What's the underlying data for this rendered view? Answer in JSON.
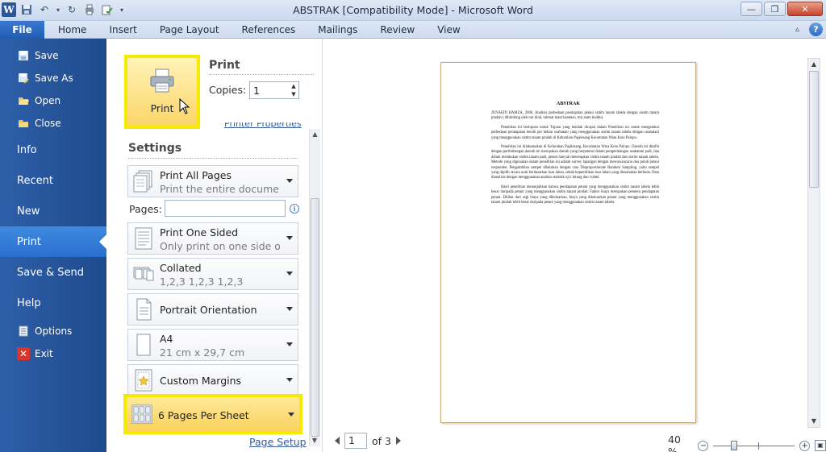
{
  "window": {
    "title": "ABSTRAK [Compatibility Mode]  -  Microsoft Word",
    "app_icon_letter": "W",
    "minimize_glyph": "—",
    "maximize_glyph": "❐",
    "close_glyph": "✕"
  },
  "ribbon": {
    "file_tab": "File",
    "tabs": [
      "Home",
      "Insert",
      "Page Layout",
      "References",
      "Mailings",
      "Review",
      "View"
    ],
    "help_glyph": "?"
  },
  "nav": {
    "items_small": [
      {
        "label": "Save",
        "icon": "save-icon"
      },
      {
        "label": "Save As",
        "icon": "save-as-icon"
      },
      {
        "label": "Open",
        "icon": "open-folder-icon"
      },
      {
        "label": "Close",
        "icon": "close-folder-icon"
      }
    ],
    "items_big": [
      "Info",
      "Recent",
      "New",
      "Print",
      "Save & Send",
      "Help"
    ],
    "selected": "Print",
    "options_label": "Options",
    "exit_label": "Exit"
  },
  "print_panel": {
    "print_button_label": "Print",
    "heading": "Print",
    "copies_label": "Copies:",
    "copies_value": "1",
    "printer_properties_link": "Printer Properties"
  },
  "settings": {
    "heading": "Settings",
    "print_range": {
      "title": "Print All Pages",
      "subtitle": "Print the entire document"
    },
    "pages_label": "Pages:",
    "pages_value": "",
    "sides": {
      "title": "Print One Sided",
      "subtitle": "Only print on one side of th..."
    },
    "collation": {
      "title": "Collated",
      "subtitle": "1,2,3    1,2,3    1,2,3"
    },
    "orientation": {
      "title": "Portrait Orientation"
    },
    "paper": {
      "title": "A4",
      "subtitle": "21 cm x 29,7 cm"
    },
    "margins": {
      "title": "Custom Margins"
    },
    "pages_per_sheet": {
      "title": "6 Pages Per Sheet"
    },
    "page_setup_link": "Page Setup"
  },
  "preview": {
    "doc_title": "ABSTRAK",
    "paragraphs": [
      "JUNAEDI HAMZA, 2006. Analisis perbedaan pendapatan petani sistim tanam tabela dengan sistim tanam pindah ( dibimbing oleh nur hilal, rahmat mant bandaso, mir alam boddu).",
      "Penelitian ini bertujuan untuk Tujuan yang hendak dicapai dalam Penelitian ini untuk mengetahui perbedaan pendapatan bersih per hektar usahatani yang menggunakan sistim tanam tabela dengan usahatani yang menggunakan sistim tanam pindah di Kelurahan Pajalesang Kecamatan Wara Kota Palopo.",
      "Penelitian ini dilaksanakan di Kelurahan Pajalesang, Kecamatan Wara Kota Palopo. Daerah ini dipilih dengan pertimbangan daerah ini merupakan daerah yang berpotensi dalam pengembangan usahatani padi, dan dalam melakukan sistim tanam padi, petani banyak menerapkan sistim tanam pindah dan sistim tanam tabela. Metode yang digunakan dalam penelitian ini adalah survey lapangan dengan mewawancarai dua puluh petani responden. Pengambilan sampel dilakukan dengan cara Disproportionate Random Sampling, yaitu sampel yang dipilih secara acak berdasarkan luas lahan, sebab kepemilikan luas lahan yang diusahakan berbeda. Data dianalisis dengan menggunakan analisis statistik uji t hitung dan t tabel.",
      "Hasil penelitian menunjukkan bahwa pendapatan petani yang menggunakan sistim tanam tabela lebih besar daripada petani yang menggunakan sistim tanam pindah. Faktor biaya merupakan penentu pendapatan petani. Dilihat dari segi biaya yang dikeluarkan, biaya yang dikeluarkan petani yang menggunakan sistim tanam pindah lebih besar daripada petani yang menggunakan sistim tanam tabela."
    ],
    "current_page": "1",
    "of_pages": "of 3",
    "zoom_level": "40 %",
    "zoom_minus": "−",
    "zoom_plus": "+"
  },
  "colors": {
    "nav_bg": "#2d5fa8",
    "nav_selected": "#3f8ae0",
    "highlight_border": "#f5ea00",
    "highlight_fill": "#fbd568",
    "link": "#345a9b"
  }
}
